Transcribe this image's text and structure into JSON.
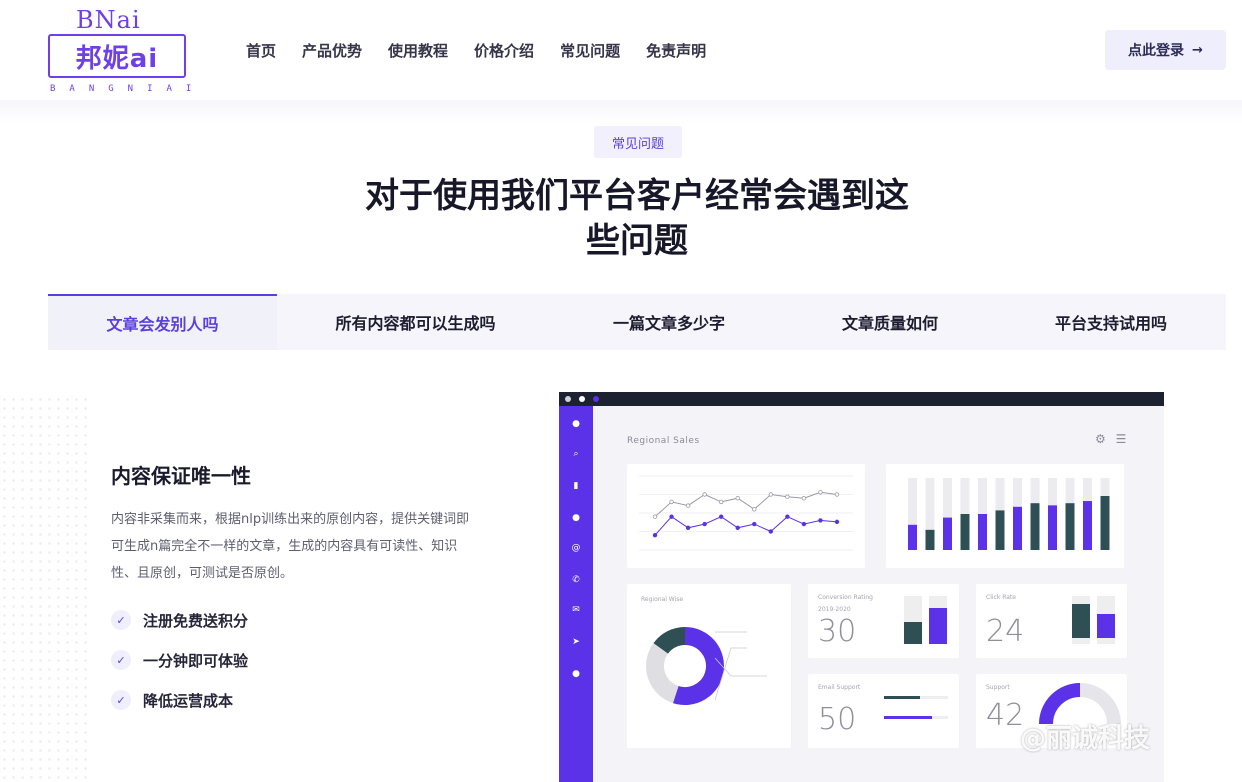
{
  "header": {
    "logo_top": "BNai",
    "logo_main": "邦妮ai",
    "logo_sub": "BANGNIAI",
    "nav": [
      "首页",
      "产品优势",
      "使用教程",
      "价格介绍",
      "常见问题",
      "免责声明"
    ],
    "login_label": "点此登录",
    "login_arrow": "→"
  },
  "section": {
    "tag": "常见问题",
    "heading_line1": "对于使用我们平台客户经常会遇到这",
    "heading_line2": "些问题"
  },
  "tabs": [
    {
      "label": "文章会发别人吗",
      "active": true
    },
    {
      "label": "所有内容都可以生成吗",
      "active": false
    },
    {
      "label": "一篇文章多少字",
      "active": false
    },
    {
      "label": "文章质量如何",
      "active": false
    },
    {
      "label": "平台支持试用吗",
      "active": false
    }
  ],
  "content": {
    "title": "内容保证唯一性",
    "description": "内容非采集而来，根据nlp训练出来的原创内容，提供关键词即可生成n篇完全不一样的文章，生成的内容具有可读性、知识性、且原创，可测试是否原创。",
    "features": [
      "注册免费送积分",
      "一分钟即可体验",
      "降低运营成本"
    ],
    "check_icon": "✓"
  },
  "dashboard": {
    "title": "Regional Sales",
    "card_labels": {
      "region": "Regional Wise",
      "conversion": "Conversion Rating",
      "conversion_years": "2019-2020",
      "click": "Click Rate",
      "email": "Email Support",
      "support": "Support"
    },
    "numbers": {
      "conversion": "30",
      "click": "24",
      "email": "50",
      "support": "42"
    },
    "line_series_a": [
      0.55,
      0.35,
      0.4,
      0.25,
      0.35,
      0.3,
      0.45,
      0.25,
      0.28,
      0.3,
      0.22,
      0.25
    ],
    "line_series_b": [
      0.8,
      0.55,
      0.7,
      0.65,
      0.55,
      0.7,
      0.65,
      0.75,
      0.55,
      0.65,
      0.6,
      0.62
    ],
    "bar_values": [
      0.35,
      0.28,
      0.45,
      0.5,
      0.5,
      0.55,
      0.6,
      0.65,
      0.62,
      0.65,
      0.68,
      0.75
    ],
    "donut_fractions": [
      0.55,
      0.3,
      0.15
    ],
    "accent": "#5b32e8",
    "dark": "#2e5055"
  },
  "watermark": "@丽诚科技"
}
